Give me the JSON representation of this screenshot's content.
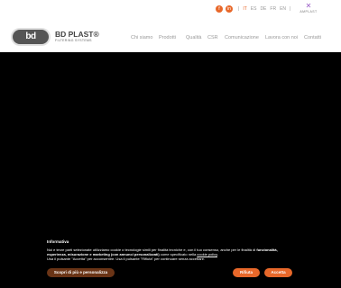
{
  "brand": {
    "logo_mark": "bd",
    "title": "BD PLAST®",
    "subtitle": "FILTERING SYSTEMS",
    "partner_mark": "AMPLAST"
  },
  "social": [
    "f-icon",
    "in-icon"
  ],
  "social_labels": [
    "f",
    "in"
  ],
  "languages": {
    "separator": "|",
    "items": [
      "IT",
      "ES",
      "DE",
      "FR",
      "EN"
    ],
    "active": "IT"
  },
  "nav": {
    "items": [
      "Chi siamo",
      "Prodotti",
      "Qualità",
      "CSR",
      "Comunicazione",
      "Lavora con noi",
      "Contatti"
    ]
  },
  "cookie": {
    "title": "Informativa",
    "text_part1": "Noi e terze parti selezionate utilizziamo cookie o tecnologie simili per finalità tecniche e, con il tuo consenso, anche per le finalità di ",
    "text_bold": "funzionalità, esperienza, misurazione e marketing (con annunci personalizzati)",
    "text_part2": " come specificato nella ",
    "link": "cookie policy",
    "text_part3": ".",
    "text_line2": "Usa il pulsante \"Accetta\" per acconsentire. Usa il pulsante \"Rifiuta\" per continuare senza accettare.",
    "buttons": {
      "more": "Scopri di più e personalizza",
      "reject": "Rifiuta",
      "accept": "Accetta"
    }
  },
  "colors": {
    "accent": "#e8682a",
    "button_dark": "#6a3416"
  }
}
